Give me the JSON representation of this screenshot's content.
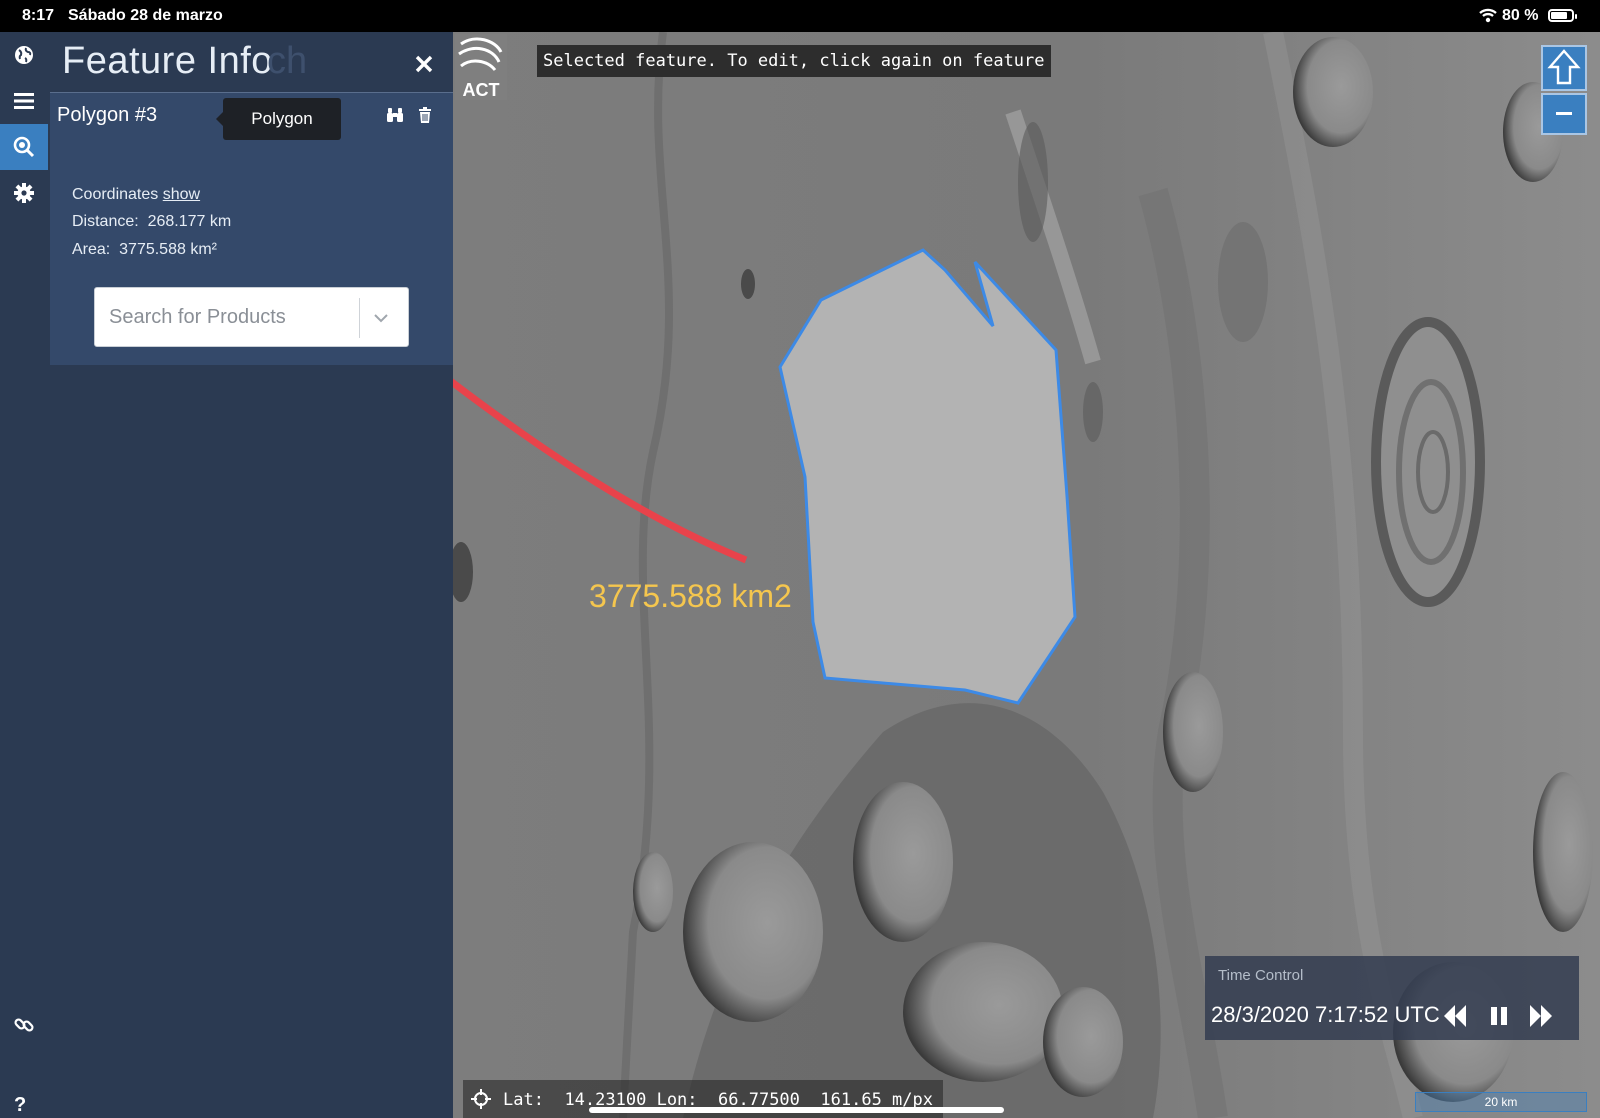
{
  "status": {
    "time": "8:17",
    "date": "Sábado 28 de marzo",
    "battery": "80 %",
    "battery_level": 0.8
  },
  "rail": {
    "items": [
      "globe-icon",
      "menu-icon",
      "search-map-icon",
      "settings-icon"
    ],
    "bottom": [
      "link-icon",
      "help-icon"
    ],
    "help_label": "?"
  },
  "panel": {
    "title": "Feature Info",
    "title_ghost": "ch",
    "feature_name": "Polygon #3",
    "tooltip": "Polygon",
    "coordinates_label": "Coordinates",
    "coordinates_link": "show",
    "distance_label": "Distance:",
    "distance_value": "268.177 km",
    "area_label": "Area:",
    "area_value": "3775.588 km²",
    "search_placeholder": "Search for Products"
  },
  "map": {
    "banner": "Selected feature. To edit, click again on feature",
    "logo_text": "ACT",
    "annotation": "3775.588 km2",
    "annotation_color": "#f5c64e",
    "polygon_color": "#3d8ae6",
    "arrow_color": "#e8434b",
    "time_control": {
      "title": "Time Control",
      "datetime": "28/3/2020 7:17:52 UTC"
    },
    "coords": {
      "lat_label": "Lat:",
      "lat": "14.23100",
      "lon_label": "Lon:",
      "lon": "66.77500",
      "resolution": "161.65 m/px"
    },
    "scale": "20 km"
  }
}
